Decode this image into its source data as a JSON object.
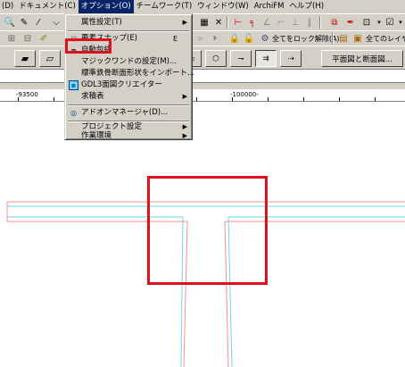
{
  "menubar": {
    "items": [
      "(D)",
      "ドキュメント(C)",
      "オプション(O)",
      "チームワーク(T)",
      "ウィンドウ(W)",
      "ArchiFM",
      "ヘルプ(H)"
    ]
  },
  "toolbar2": {
    "lock_all_label": "全てをロック解除(A)",
    "all_layers_label": "全てのレイヤー"
  },
  "toolbar3": {
    "plan_section_label": "平面図と断面図..."
  },
  "ruler": {
    "left_label": "-93500",
    "right_label": "-100000-"
  },
  "dropdown": {
    "items": [
      {
        "label": "属性設定(T)",
        "submenu": true,
        "shortcut": ""
      },
      {
        "label": "要素スナップ(E)",
        "submenu": false,
        "shortcut": "E"
      },
      {
        "label": "自動包絡",
        "submenu": false,
        "shortcut": ""
      },
      {
        "label": "マジックワンドの設定(M)...",
        "submenu": false,
        "shortcut": ""
      },
      {
        "label": "標準鉄骨断面形状をインポート...",
        "submenu": false,
        "shortcut": ""
      },
      {
        "label": "GDL3面図クリエイター",
        "submenu": false,
        "shortcut": ""
      },
      {
        "label": "求積表",
        "submenu": true,
        "shortcut": ""
      },
      {
        "label": "アドオンマネージャ(D)...",
        "submenu": false,
        "shortcut": ""
      },
      {
        "label": "プロジェクト設定",
        "submenu": true,
        "shortcut": ""
      },
      {
        "label": "作業環境",
        "submenu": true,
        "shortcut": ""
      }
    ]
  },
  "colors": {
    "highlight": "#e0101a",
    "wall_red": "#ff8080",
    "wall_cyan": "#66d9e6"
  }
}
